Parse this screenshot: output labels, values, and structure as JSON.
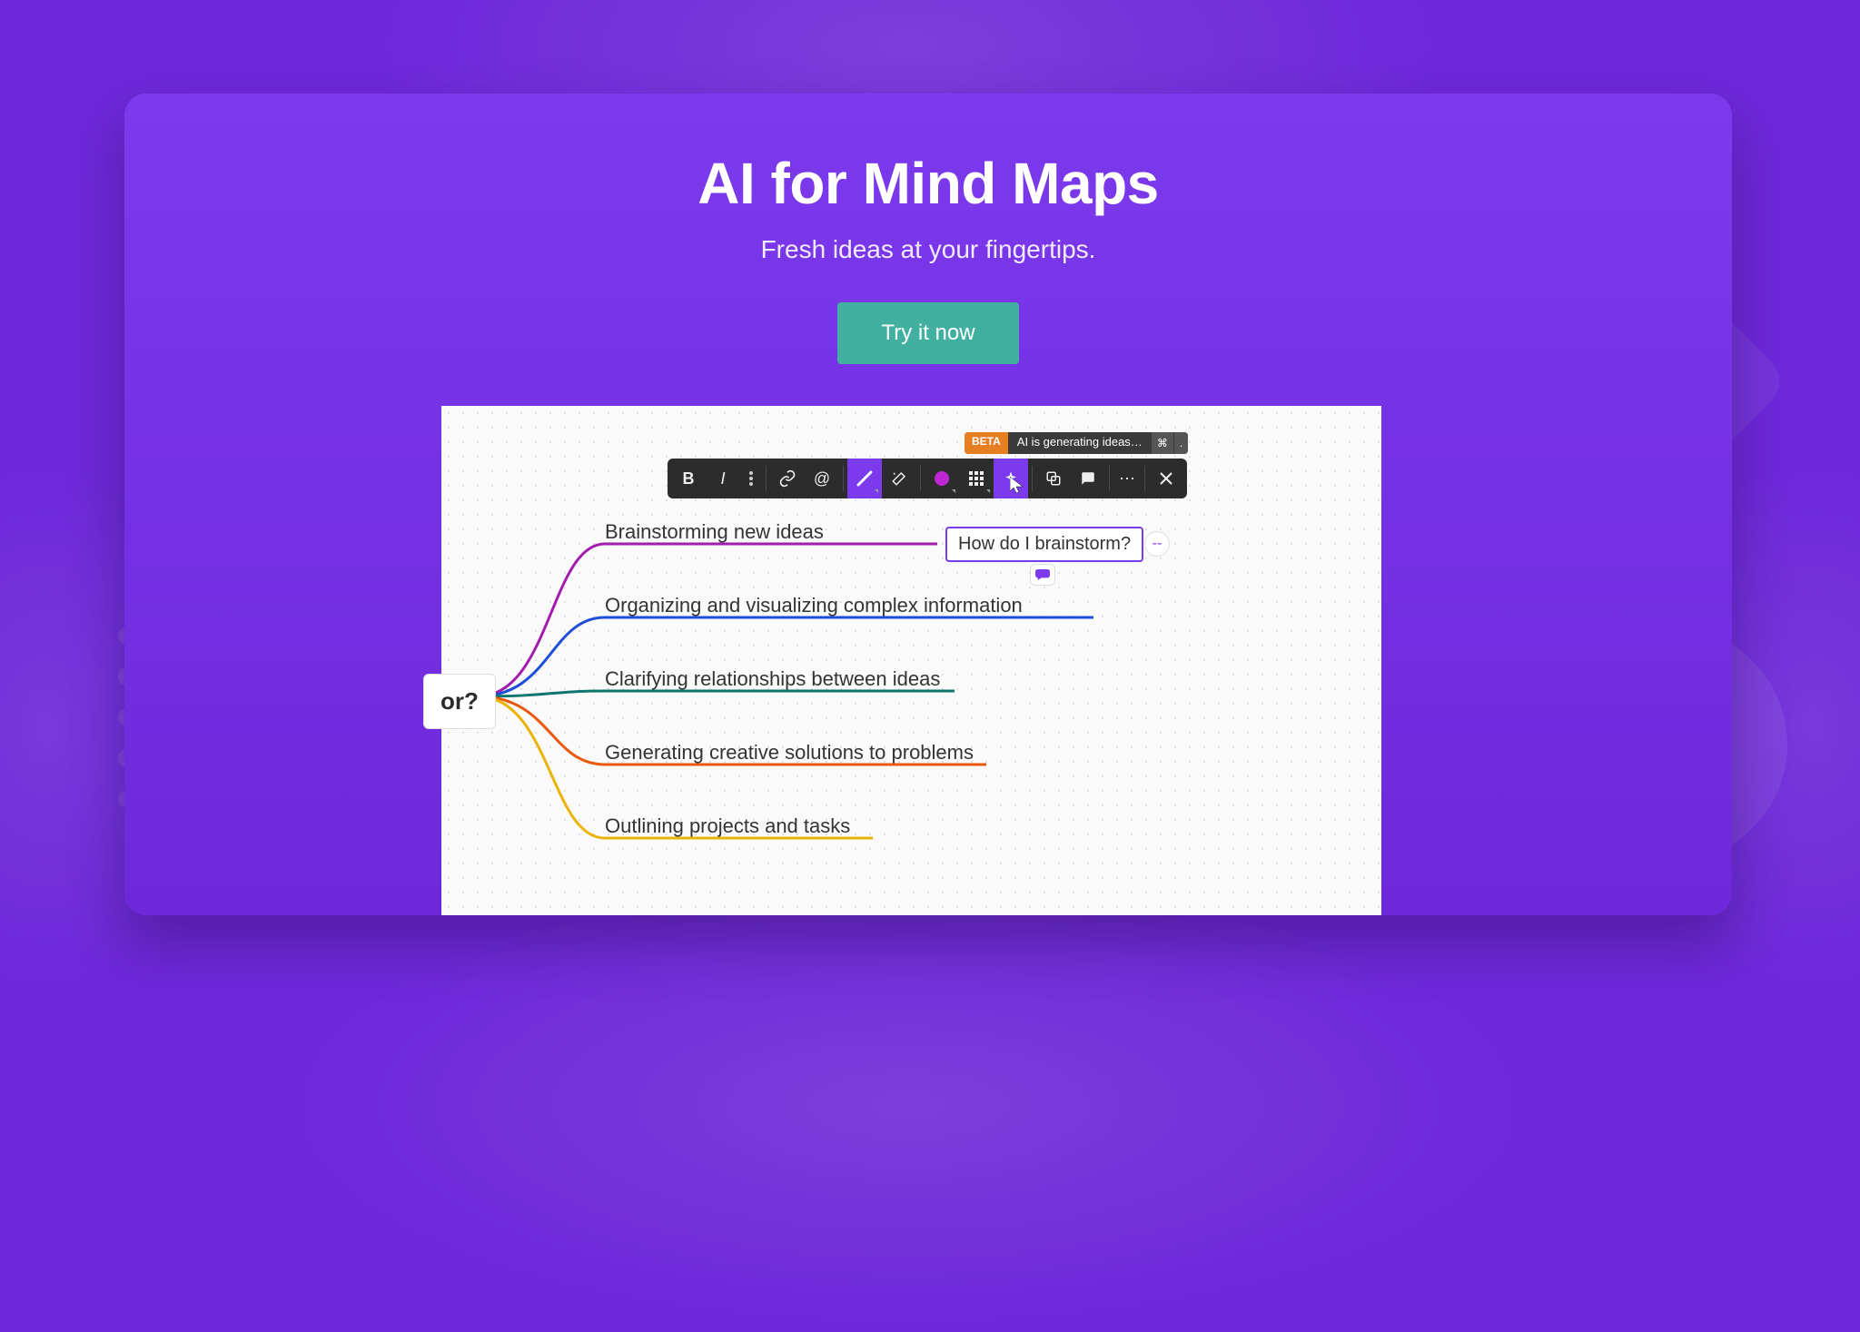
{
  "hero": {
    "title": "AI for Mind Maps",
    "subtitle": "Fresh ideas at your fingertips.",
    "cta": "Try it now"
  },
  "tooltip": {
    "badge": "BETA",
    "text": "AI is generating ideas…",
    "key1": "⌘",
    "key2": "."
  },
  "toolbar_icons": {
    "bold": "bold-icon",
    "italic": "italic-icon",
    "more_text": "more-text-icon",
    "link": "link-icon",
    "mention": "mention-icon",
    "line": "line-color-icon",
    "wand": "wand-icon",
    "fill": "fill-color-icon",
    "grid": "grid-icon",
    "ai": "ai-icon",
    "copy": "copy-icon",
    "comment": "comment-icon",
    "overflow": "overflow-icon",
    "close": "close-icon"
  },
  "mindmap": {
    "root_fragment": "or?",
    "branches": [
      {
        "label": "Brainstorming new ideas",
        "color": "#a21caf"
      },
      {
        "label": "Organizing and visualizing complex information",
        "color": "#1d4ed8"
      },
      {
        "label": "Clarifying relationships between ideas",
        "color": "#0f766e"
      },
      {
        "label": "Generating creative solutions to problems",
        "color": "#ea580c"
      },
      {
        "label": "Outlining projects and tasks",
        "color": "#eab308"
      }
    ],
    "sub_node": "How do I brainstorm?"
  }
}
